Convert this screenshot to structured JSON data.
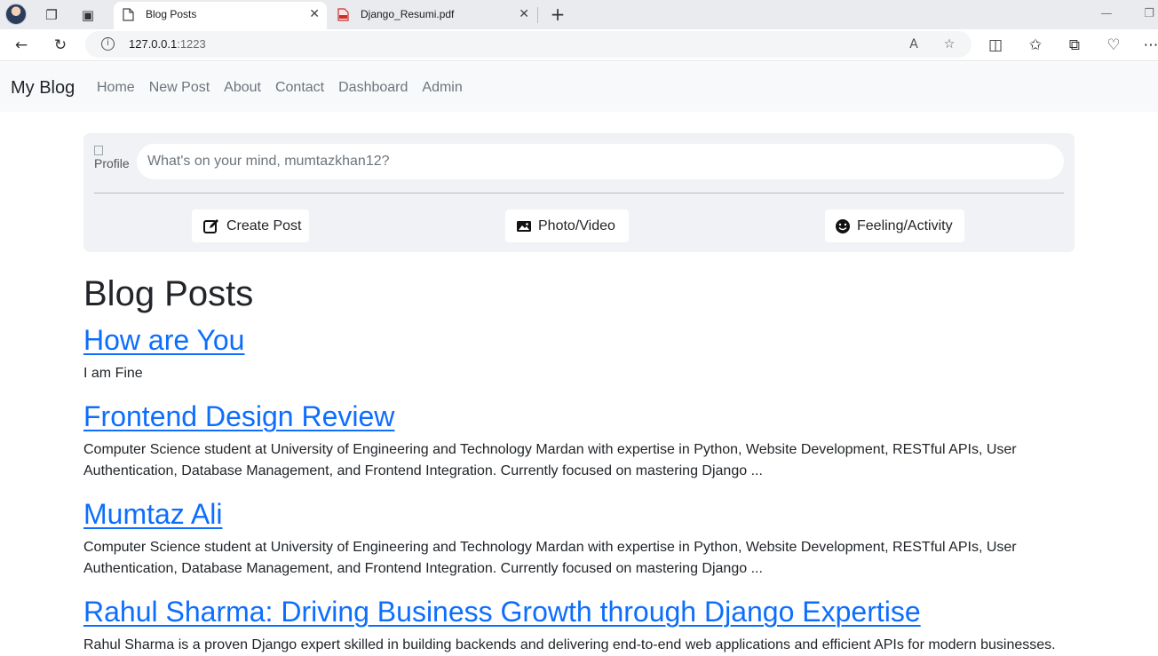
{
  "browser": {
    "tabs": [
      {
        "title": "Blog Posts",
        "active": true
      },
      {
        "title": "Django_Resumi.pdf",
        "active": false
      }
    ],
    "url_host": "127.0.0.1",
    "url_port": ":1223"
  },
  "navbar": {
    "brand": "My Blog",
    "links": [
      "Home",
      "New Post",
      "About",
      "Contact",
      "Dashboard",
      "Admin"
    ]
  },
  "composer": {
    "profile_alt": "Profile",
    "placeholder": "What's on your mind, mumtazkhan12?",
    "actions": [
      {
        "label": "Create Post",
        "icon": "edit-icon"
      },
      {
        "label": "Photo/Video",
        "icon": "image-icon"
      },
      {
        "label": "Feeling/Activity",
        "icon": "smile-icon"
      }
    ]
  },
  "page_heading": "Blog Posts",
  "posts": [
    {
      "title": "How are You",
      "body": "I am Fine"
    },
    {
      "title": "Frontend Design Review",
      "body": "Computer Science student at University of Engineering and Technology Mardan with expertise in Python, Website Development, RESTful APIs, User Authentication, Database Management, and Frontend Integration. Currently focused on mastering Django ..."
    },
    {
      "title": "Mumtaz Ali",
      "body": "Computer Science student at University of Engineering and Technology Mardan with expertise in Python, Website Development, RESTful APIs, User Authentication, Database Management, and Frontend Integration. Currently focused on mastering Django ..."
    },
    {
      "title": "Rahul Sharma: Driving Business Growth through Django Expertise",
      "body": "Rahul Sharma is a proven Django expert skilled in building backends and delivering end-to-end web applications and efficient APIs for modern businesses."
    }
  ],
  "colors": {
    "link": "#0d6efd",
    "navbar_bg": "#f8f9fa",
    "composer_bg": "#f0f2f5"
  }
}
